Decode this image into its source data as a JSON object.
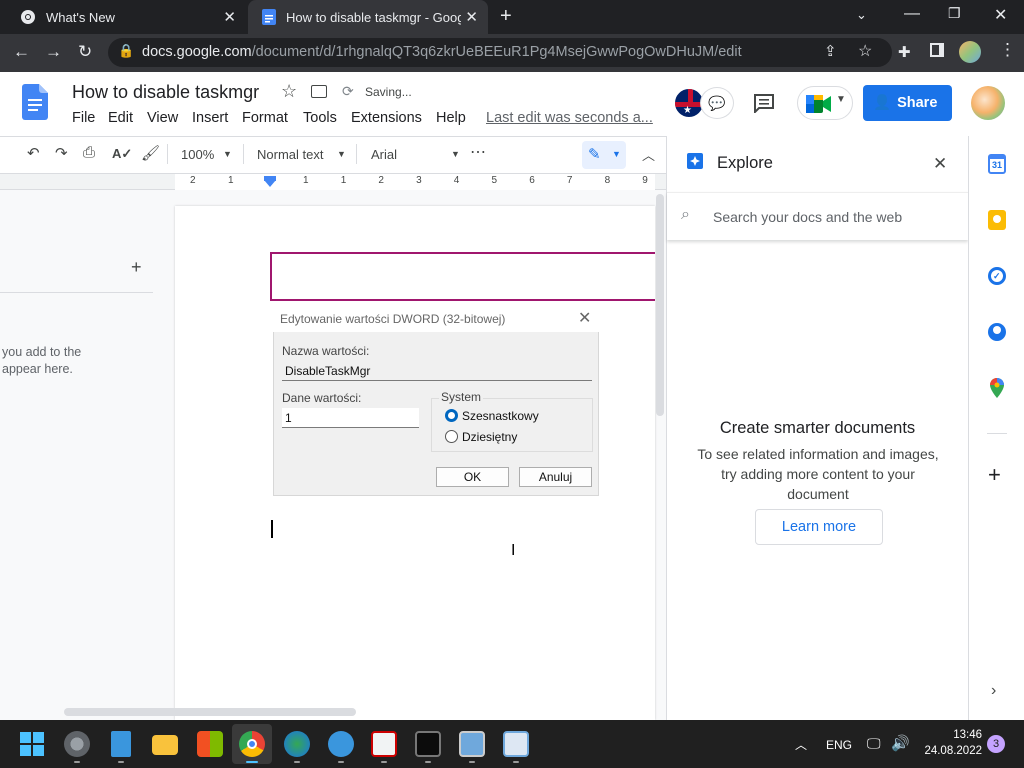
{
  "browser": {
    "tabs": [
      {
        "title": "What's New"
      },
      {
        "title": "How to disable taskmgr - Google"
      }
    ],
    "url_host": "docs.google.com",
    "url_path": "/document/d/1rhgnalqQT3q6zkrUeBEEuR1Pg4MsejGwwPogOwDHuJM/edit"
  },
  "doc": {
    "title": "How to disable taskmgr",
    "saving_status": "Saving...",
    "menu": [
      "File",
      "Edit",
      "View",
      "Insert",
      "Format",
      "Tools",
      "Extensions",
      "Help"
    ],
    "last_edit": "Last edit was seconds a...",
    "share_label": "Share"
  },
  "toolbar": {
    "zoom": "100%",
    "style": "Normal text",
    "font": "Arial"
  },
  "ruler": {
    "ticks": [
      "2",
      "1",
      "1",
      "1",
      "2",
      "3",
      "4",
      "5",
      "6",
      "7",
      "8",
      "9",
      "10"
    ]
  },
  "outline": {
    "hint": "you add to the\nappear here."
  },
  "dialog": {
    "title": "Edytowanie wartości DWORD (32-bitowej)",
    "name_label": "Nazwa wartości:",
    "name_value": "DisableTaskMgr",
    "data_label": "Dane wartości:",
    "data_value": "1",
    "system_label": "System",
    "radio_hex": "Szesnastkowy",
    "radio_dec": "Dziesiętny",
    "ok": "OK",
    "cancel": "Anuluj"
  },
  "explore": {
    "title": "Explore",
    "search_placeholder": "Search your docs and the web",
    "heading": "Create smarter documents",
    "body": "To see related information and images, try adding more content to your document",
    "learn_more": "Learn more"
  },
  "taskbar": {
    "lang": "ENG",
    "time": "13:46",
    "date": "24.08.2022",
    "badge": "3"
  },
  "colors": {
    "docs_blue": "#4285f4",
    "share_blue": "#1a73e8",
    "highlight_border": "#a0166e"
  }
}
